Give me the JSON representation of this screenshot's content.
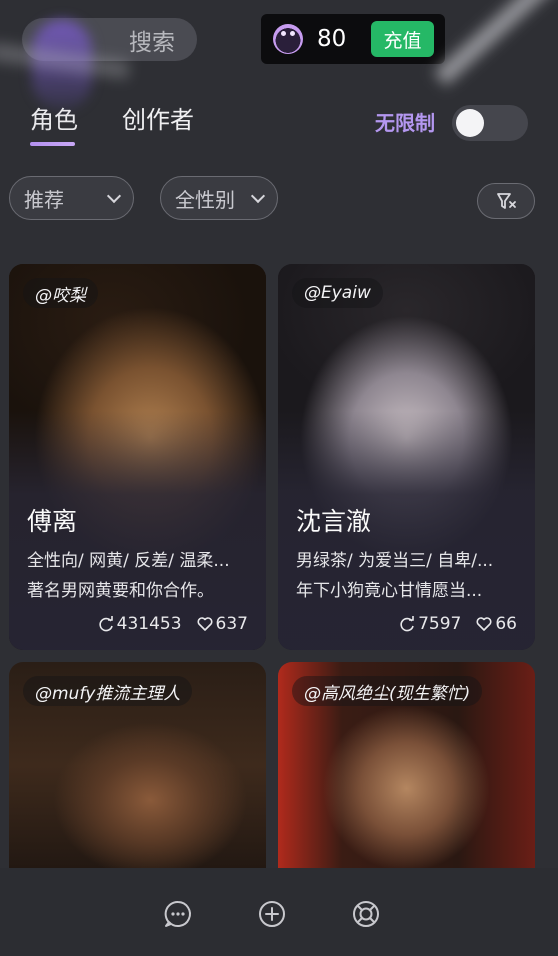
{
  "header": {
    "search_label": "搜索",
    "coin_count": "80",
    "recharge_label": "充值"
  },
  "tabs": {
    "role_label": "角色",
    "creator_label": "创作者",
    "unlimited_label": "无限制",
    "unlimited_on": false
  },
  "filters": {
    "sort_value": "推荐",
    "gender_value": "全性别"
  },
  "cards": [
    {
      "author": "@咬梨",
      "name": "傅离",
      "tags": "全性向/ 网黄/ 反差/ 温柔...",
      "desc": "著名男网黄要和你合作。",
      "chats": "431453",
      "likes": "637"
    },
    {
      "author": "@Eyaiw",
      "name": "沈言澈",
      "tags": "男绿茶/ 为爱当三/ 自卑/...",
      "desc": "年下小狗竟心甘情愿当...",
      "chats": "7597",
      "likes": "66"
    },
    {
      "author": "@mufy推流主理人"
    },
    {
      "author": "@高风绝尘(现生繁忙)"
    }
  ],
  "colors": {
    "accent": "#b491f0",
    "recharge": "#25b866",
    "background": "#2e2f34"
  },
  "bottom_nav": {
    "icons": [
      "chat-icon",
      "add-icon",
      "lifebuoy-icon"
    ]
  }
}
